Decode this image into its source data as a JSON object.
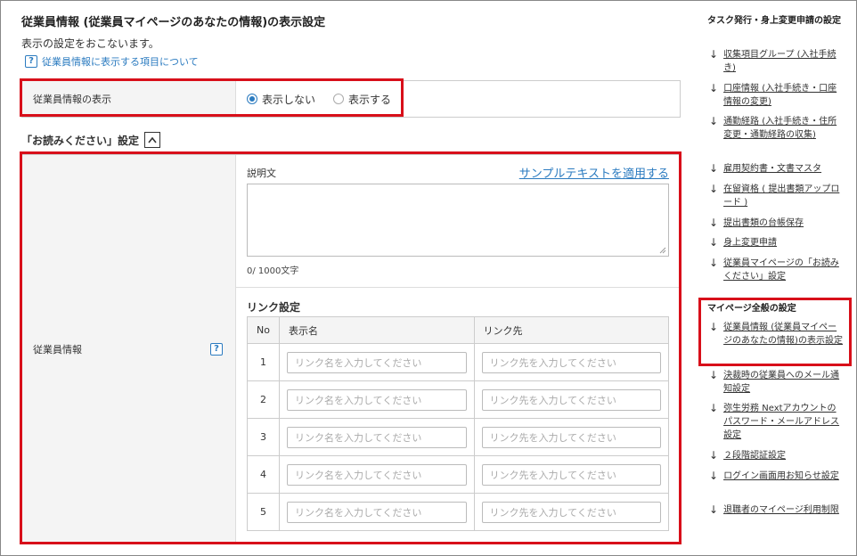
{
  "page": {
    "title": "従業員情報 (従業員マイページのあなたの情報)の表示設定",
    "description": "表示の設定をおこないます。",
    "help_link": "従業員情報に表示する項目について"
  },
  "display_setting": {
    "label": "従業員情報の表示",
    "options": [
      {
        "label": "表示しない",
        "selected": true
      },
      {
        "label": "表示する",
        "selected": false
      }
    ]
  },
  "section": {
    "title": "「お読みください」設定",
    "collapse_icon": "chevron-up-icon"
  },
  "yomi": {
    "row_label": "従業員情報",
    "description_label": "説明文",
    "sample_link": "サンプルテキストを適用する",
    "char_count": "0/ 1000文字",
    "link_settings_label": "リンク設定",
    "table": {
      "headers": [
        "No",
        "表示名",
        "リンク先"
      ],
      "rows": [
        {
          "no": "1",
          "name_placeholder": "リンク名を入力してください",
          "url_placeholder": "リンク先を入力してください"
        },
        {
          "no": "2",
          "name_placeholder": "リンク名を入力してください",
          "url_placeholder": "リンク先を入力してください"
        },
        {
          "no": "3",
          "name_placeholder": "リンク名を入力してください",
          "url_placeholder": "リンク先を入力してください"
        },
        {
          "no": "4",
          "name_placeholder": "リンク名を入力してください",
          "url_placeholder": "リンク先を入力してください"
        },
        {
          "no": "5",
          "name_placeholder": "リンク名を入力してください",
          "url_placeholder": "リンク先を入力してください"
        }
      ]
    }
  },
  "sidebar": {
    "group1_title": "タスク発行・身上変更申請の設定",
    "group1_items": [
      "収集項目グループ (入社手続き)",
      "口座情報 (入社手続き・口座情報の変更)",
      "通勤経路 (入社手続き・住所変更・通勤経路の収集)",
      "雇用契約書・文書マスタ",
      "在留資格 ( 提出書類アップロード )",
      "提出書類の台帳保存",
      "身上変更申請",
      "従業員マイページの「お読みください」設定"
    ],
    "group2_title": "マイページ全般の設定",
    "group2_items": [
      "従業員情報 (従業員マイページのあなたの情報)の表示設定",
      "決裁時の従業員へのメール通知設定",
      "弥生労務 Nextアカウントのパスワード・メールアドレス設定",
      "２段階認証設定",
      "ログイン画面用お知らせ設定",
      "退職者のマイページ利用制限"
    ],
    "arrow_icon": "arrow-down-icon"
  },
  "colors": {
    "accent": "#2b7bc0",
    "highlight": "#d80f1a"
  }
}
